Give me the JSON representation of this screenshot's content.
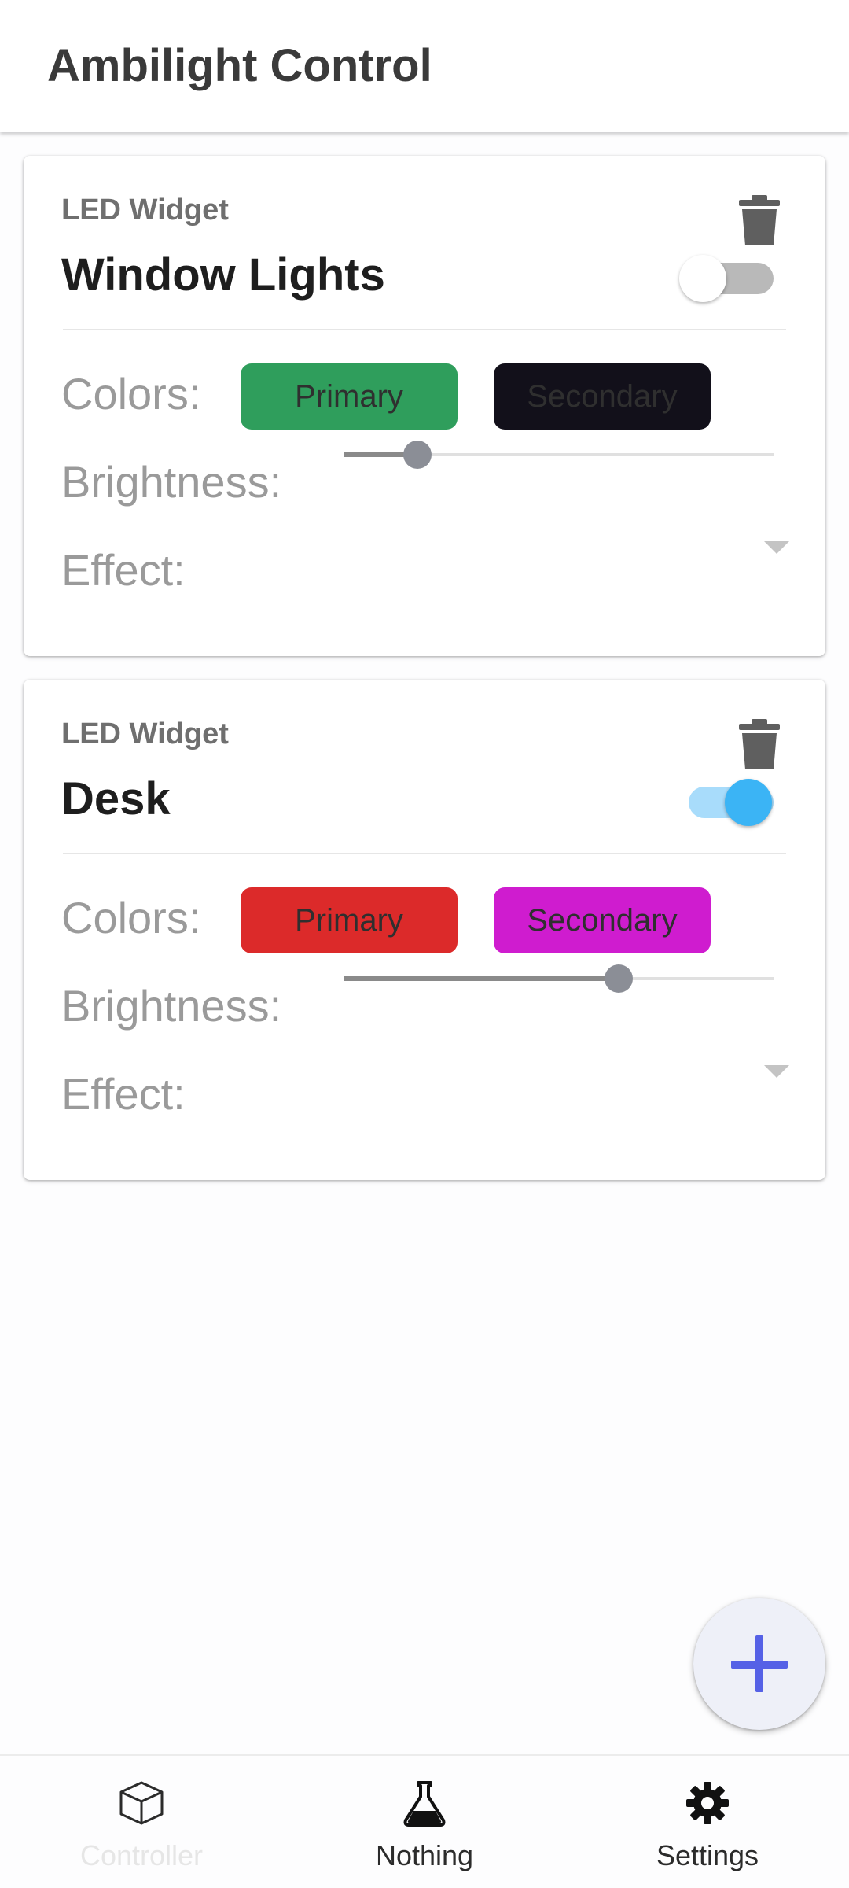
{
  "app_bar": {
    "title": "Ambilight Control"
  },
  "cards": [
    {
      "subtitle": "LED Widget",
      "title": "Window Lights",
      "enabled": false,
      "colors_label": "Colors:",
      "primary_label": "Primary",
      "primary_color": "#2f9e5c",
      "secondary_label": "Secondary",
      "secondary_color": "#12101a",
      "brightness_label": "Brightness:",
      "brightness": 0.17,
      "effect_label": "Effect:",
      "effect_value": ""
    },
    {
      "subtitle": "LED Widget",
      "title": "Desk",
      "enabled": true,
      "colors_label": "Colors:",
      "primary_label": "Primary",
      "primary_color": "#dc2a2a",
      "secondary_label": "Secondary",
      "secondary_color": "#cf1ccf",
      "brightness_label": "Brightness:",
      "brightness": 0.64,
      "effect_label": "Effect:",
      "effect_value": ""
    }
  ],
  "fab": {
    "icon": "plus-icon",
    "color": "#5561e6"
  },
  "bottom_nav": [
    {
      "label": "Controller",
      "icon": "cube-icon",
      "active": false,
      "color": "#e6e6e6"
    },
    {
      "label": "Nothing",
      "icon": "flask-icon",
      "active": true,
      "color": "#2b2b2b"
    },
    {
      "label": "Settings",
      "icon": "gear-icon",
      "active": true,
      "color": "#2b2b2b"
    }
  ],
  "colors": {
    "toggle_on_track": "#a8dcfb",
    "toggle_on_knob": "#3bb4f5",
    "toggle_off_track": "#b9b9b9",
    "toggle_off_knob": "#ffffff"
  }
}
